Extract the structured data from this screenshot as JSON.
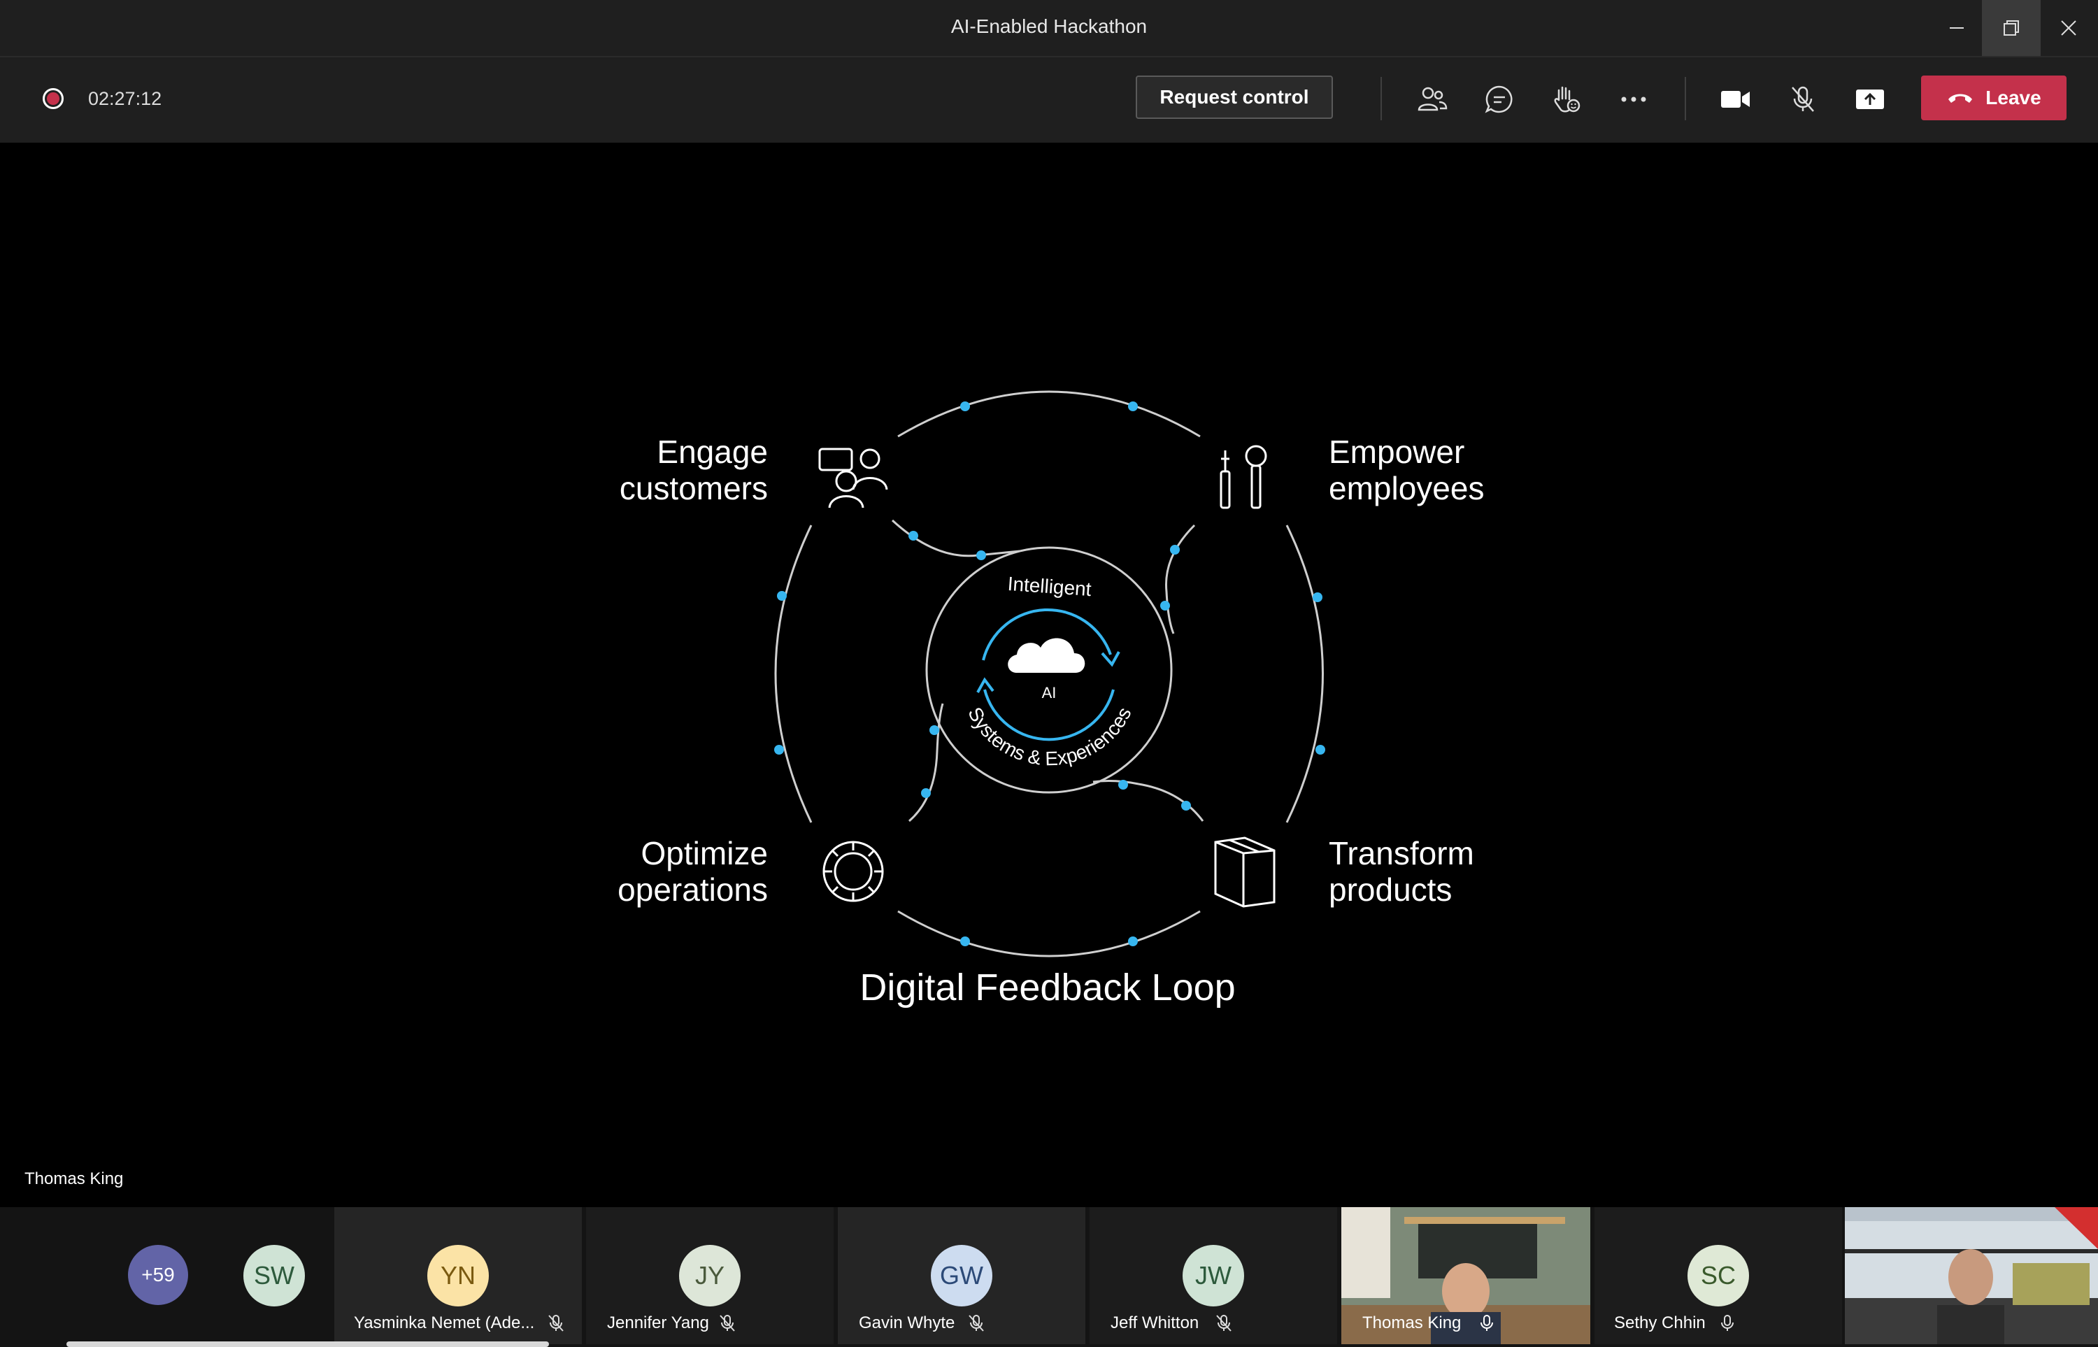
{
  "window": {
    "title": "AI-Enabled Hackathon"
  },
  "toolbar": {
    "timer": "02:27:12",
    "request_control": "Request control",
    "leave": "Leave"
  },
  "slide": {
    "center_top": "Intelligent",
    "center_ai": "AI",
    "center_bottom": "Systems & Experiences",
    "q1_line1": "Engage",
    "q1_line2": "customers",
    "q2_line1": "Empower",
    "q2_line2": "employees",
    "q3_line1": "Optimize",
    "q3_line2": "operations",
    "q4_line1": "Transform",
    "q4_line2": "products",
    "caption": "Digital Feedback Loop"
  },
  "stage": {
    "presenter": "Thomas King"
  },
  "participants": {
    "overflow": "+59",
    "tiles": [
      {
        "initials": "SW",
        "name": ""
      },
      {
        "initials": "YN",
        "name": "Yasminka Nemet (Ade..."
      },
      {
        "initials": "JY",
        "name": "Jennifer Yang"
      },
      {
        "initials": "GW",
        "name": "Gavin Whyte"
      },
      {
        "initials": "JW",
        "name": "Jeff Whitton"
      },
      {
        "initials": "",
        "name": "Thomas King"
      },
      {
        "initials": "SC",
        "name": "Sethy Chhin"
      }
    ]
  },
  "colors": {
    "accent": "#c4314b",
    "loop_dot": "#37b6f0",
    "bar": "#1f1f1f"
  }
}
